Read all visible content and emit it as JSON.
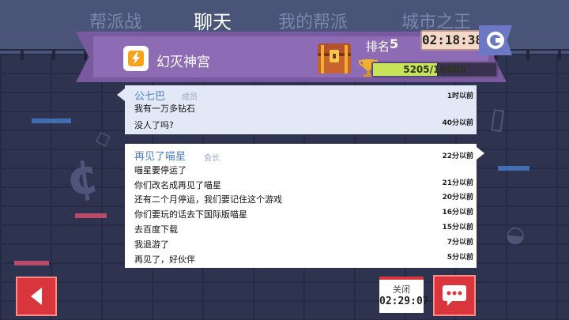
{
  "tabs": [
    {
      "label": "帮派战",
      "active": false
    },
    {
      "label": "聊天",
      "active": true
    },
    {
      "label": "我的帮派",
      "active": false
    },
    {
      "label": "城市之王",
      "active": false
    }
  ],
  "guild": {
    "name": "幻灭神宫",
    "logo_icon": "lightning-icon",
    "rank_label": "排名",
    "rank_value": "5",
    "progress_text": "5205/10000",
    "progress_fraction": 0.5205,
    "timer": "02:18:38"
  },
  "messages": [
    {
      "sender": "公七巴",
      "role": "成员",
      "lines": [
        {
          "text": "我有一万多钻石",
          "time": "1时以前"
        },
        {
          "text": "没人了吗?",
          "time": "40分以前"
        }
      ]
    },
    {
      "sender": "再见了喵星",
      "role": "会长",
      "header_time": "22分以前",
      "lines": [
        {
          "text": "喵星要停运了",
          "time": ""
        },
        {
          "text": "你们改名成再见了喵星",
          "time": "21分以前"
        },
        {
          "text": "还有二个月停运，我们要记住这个游戏",
          "time": "20分以前"
        },
        {
          "text": "你们要玩的话去下国际版喵星",
          "time": "16分以前"
        },
        {
          "text": "去百度下载",
          "time": "15分以前"
        },
        {
          "text": "我退游了",
          "time": "7分以前"
        },
        {
          "text": "再见了，好伙伴",
          "time": "5分以前"
        }
      ]
    }
  ],
  "bottom": {
    "close_label": "关闭",
    "close_time": "02:29:07"
  },
  "colors": {
    "accent_red": "#d9353c",
    "banner_purple": "#8e6cb5",
    "sender_blue": "#4d7fc4",
    "progress_green": "#c6e35a"
  }
}
